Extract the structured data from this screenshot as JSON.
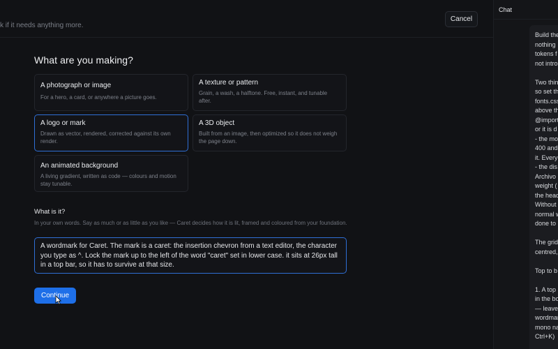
{
  "topbar": {
    "hint": "k if it needs anything more.",
    "cancel_label": "Cancel"
  },
  "main": {
    "heading": "What are you making?",
    "options": [
      {
        "title": "A photograph or image",
        "desc": "For a hero, a card, or anywhere a picture goes.",
        "selected": false
      },
      {
        "title": "A texture or pattern",
        "desc": "Grain, a wash, a halftone. Free, instant, and tunable after.",
        "selected": false
      },
      {
        "title": "A logo or mark",
        "desc": "Drawn as vector, rendered, corrected against its own render.",
        "selected": true
      },
      {
        "title": "A 3D object",
        "desc": "Built from an image, then optimized so it does not weigh the page down.",
        "selected": false
      },
      {
        "title": "An animated background",
        "desc": "A living gradient, written as code — colours and motion stay tunable.",
        "selected": false
      }
    ],
    "field_label": "What is it?",
    "field_help": "In your own words. Say as much or as little as you like — Caret decides how it is lit, framed and coloured from your foundation.",
    "field_value": "A wordmark for Caret. The mark is a caret: the insertion chevron from a text editor, the character you type as ^. Lock the mark up to the left of the word \"caret\" set in lower case. it sits at 26px tall in a top bar, so it has to survive at that size.",
    "continue_label": "Continue"
  },
  "chat": {
    "title": "Chat",
    "lines": [
      "Build the",
      "nothing",
      "tokens f",
      "not intro",
      "",
      "Two thin",
      "so set th",
      "fonts.css",
      "above th",
      "@import",
      "or it is d",
      "- the mo",
      "400 and",
      "it. Every",
      "- the dis",
      "Archivo",
      "weight (",
      "the head",
      "Without",
      "normal w",
      "done to",
      "",
      "The grid",
      "centred,",
      "",
      "Top to b",
      "",
      "1. A top",
      "in the bo",
      "— leave",
      "wordmar",
      "mono na",
      "Ctrl+K)"
    ]
  },
  "colors": {
    "accent": "#1e6fe8",
    "selected_border": "#2f6fd6",
    "background": "#111215"
  }
}
